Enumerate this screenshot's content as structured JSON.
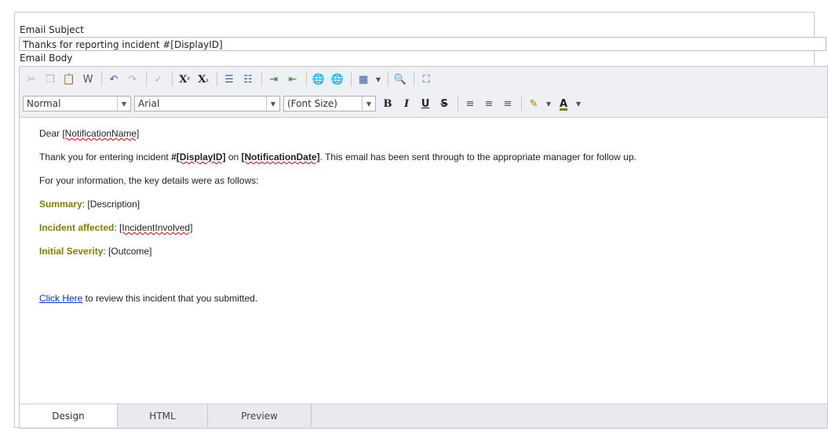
{
  "subject": {
    "label": "Email Subject",
    "value": "Thanks for reporting incident #[DisplayID]"
  },
  "body": {
    "label": "Email Body"
  },
  "toolbar": {
    "row1_icons": [
      "cut-icon",
      "copy-icon",
      "paste-icon",
      "paste-from-word-icon",
      "undo-icon",
      "redo-icon",
      "spellcheck-icon",
      "superscript-icon",
      "subscript-icon",
      "numbered-list-icon",
      "bulleted-list-icon",
      "indent-icon",
      "outdent-icon",
      "insert-link-icon",
      "remove-link-icon",
      "insert-table-icon",
      "find-icon",
      "fullscreen-icon"
    ],
    "paragraph_style": "Normal",
    "font_name": "Arial",
    "font_size": "(Font Size)",
    "bold": "B",
    "italic": "I",
    "underline": "U",
    "strike": "S",
    "font_color": "A",
    "superscript": "X",
    "subscript": "X"
  },
  "content": {
    "greeting_prefix": "Dear ",
    "greeting_token": "[NotificationName]",
    "line1_a": "Thank you for entering incident ",
    "line1_b": "#",
    "line1_c": "[DisplayID]",
    "line1_d": " on ",
    "line1_e": "[NotificationDate]",
    "line1_f": ". This email has been sent through to the appropriate manager for follow up.",
    "line2": "For your information, the key details were as follows:",
    "summary_label": "Summary",
    "summary_value": ": [Description]",
    "affected_label": "Incident affected",
    "affected_sep": ": ",
    "affected_value": "[IncidentInvolved]",
    "severity_label": "Initial Severity",
    "severity_value": ": [Outcome]",
    "link_text": "Click Here",
    "link_rest": " to review this incident that you submitted."
  },
  "tabs": [
    "Design",
    "HTML",
    "Preview"
  ],
  "colors": {
    "label_olive": "#808000",
    "link_blue": "#0033cc",
    "toolbar_bg": "#eef0f3"
  }
}
